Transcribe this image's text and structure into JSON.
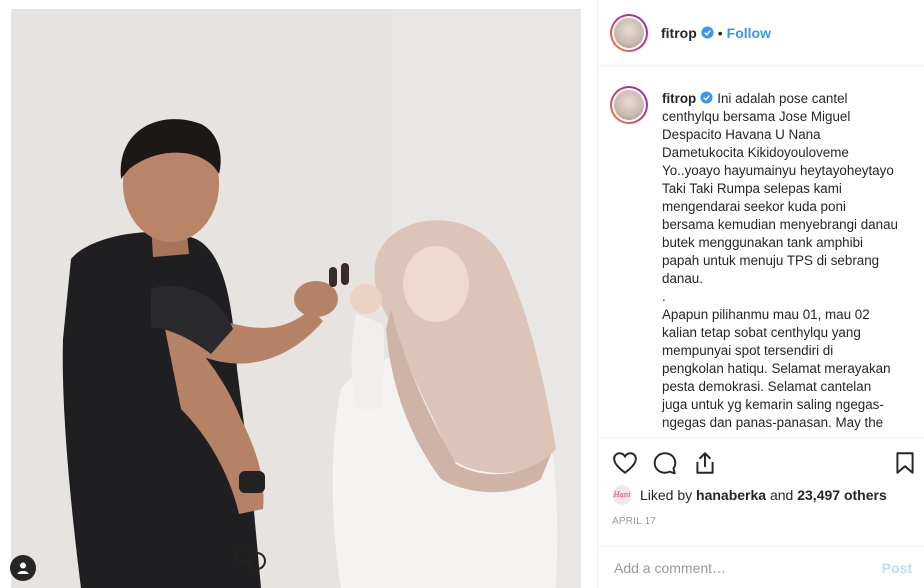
{
  "post": {
    "username": "fitrop",
    "follow_label": "Follow",
    "separator": "•",
    "caption": "Ini adalah pose cantel centhylqu bersama Jose Miguel Despacito Havana U Nana Dametukocita Kikidoyouloveme Yo..yoayo hayumainyu heytayoheytayo Taki Taki Rumpa selepas kami mengendarai seekor kuda poni bersama kemudian menyebrangi danau butek menggunakan tank amphibi papah untuk menuju TPS di sebrang danau.\n.\nApapun pilihanmu mau 01, mau 02 kalian tetap sobat centhylqu yang mempunyai spot tersendiri di pengkolan hatiqu. Selamat merayakan pesta demokrasi. Selamat cantelan juga untuk yg kemarin saling ngegas-ngegas dan panas-panasan. May the",
    "liked_by_prefix": "Liked by ",
    "liked_by_user": "hanaberka",
    "liked_by_and": " and ",
    "likes_count": "23,497 others",
    "liker_avatar_text": "Hani",
    "date": "APRIL 17",
    "comment_placeholder": "Add a comment…",
    "post_label": "Post"
  },
  "icons": {
    "verified": "verified-badge-icon",
    "like": "heart-icon",
    "comment": "comment-icon",
    "share": "share-icon",
    "save": "bookmark-icon",
    "user_tag": "user-tag-icon"
  },
  "colors": {
    "accent": "#3897f0",
    "post_disabled": "#b2dffc",
    "muted": "#999999",
    "text": "#262626"
  }
}
